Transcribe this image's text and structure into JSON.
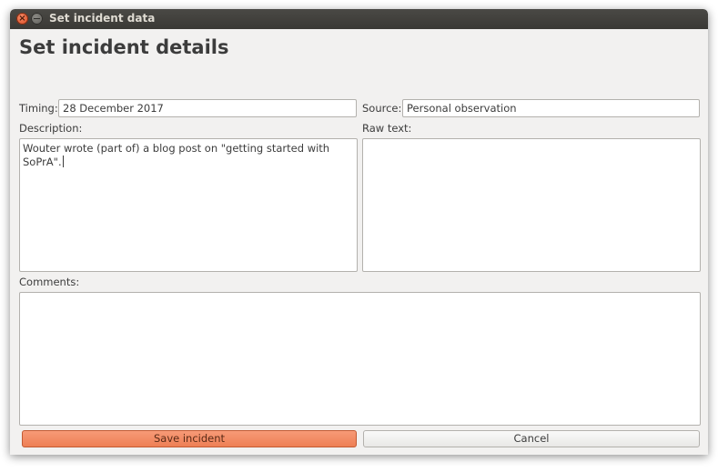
{
  "window": {
    "title": "Set incident data"
  },
  "heading": "Set incident details",
  "form": {
    "timing_label": "Timing:",
    "timing_value": "28 December 2017",
    "source_label": "Source:",
    "source_value": "Personal observation",
    "description_label": "Description:",
    "description_value": "Wouter wrote (part of) a blog post on \"getting started with SoPrA\".",
    "raw_text_label": "Raw text:",
    "raw_text_value": "",
    "comments_label": "Comments:",
    "comments_value": ""
  },
  "buttons": {
    "save_label": "Save incident",
    "cancel_label": "Cancel"
  },
  "colors": {
    "accent": "#ee7f55",
    "titlebar": "#3c3b37",
    "close": "#df4a16"
  },
  "icons": {
    "close": "close-icon",
    "minimize": "minimize-icon"
  }
}
